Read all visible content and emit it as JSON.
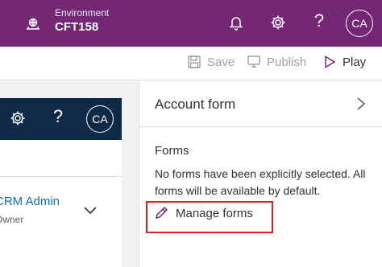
{
  "header": {
    "environment_label": "Environment",
    "environment_name": "CFT158",
    "icons": [
      "environment-icon",
      "bell-icon",
      "gear-icon",
      "help-icon"
    ],
    "help_glyph": "?",
    "avatar_initials": "CA",
    "background_color": "#742774"
  },
  "commands": {
    "save_label": "Save",
    "publish_label": "Publish",
    "play_label": "Play"
  },
  "preview": {
    "help_glyph": "?",
    "avatar_initials": "CA",
    "header_color": "#0f2a46",
    "user_title": "CRM Admin",
    "user_subtitle": "Owner"
  },
  "panel": {
    "title": "Account form",
    "section_title": "Forms",
    "description": "No forms have been explicitly selected. All forms will be available by default.",
    "manage_label": "Manage forms",
    "highlight_color": "#e31b23"
  }
}
